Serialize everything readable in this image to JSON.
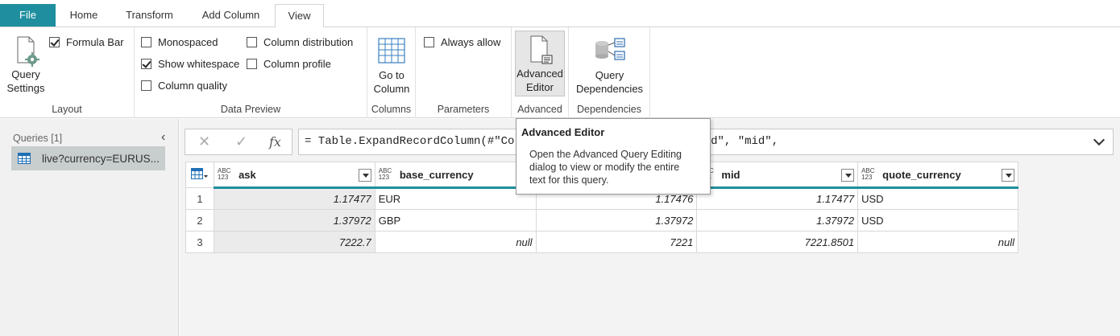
{
  "tabs": [
    {
      "label": "File"
    },
    {
      "label": "Home"
    },
    {
      "label": "Transform"
    },
    {
      "label": "Add Column"
    },
    {
      "label": "View"
    }
  ],
  "ribbon": {
    "layout": {
      "label": "Layout",
      "query_settings": [
        "Query",
        "Settings"
      ],
      "formula_bar": {
        "label": "Formula Bar",
        "checked": true
      }
    },
    "data_preview": {
      "label": "Data Preview",
      "monospaced": {
        "label": "Monospaced",
        "checked": false
      },
      "show_whitespace": {
        "label": "Show whitespace",
        "checked": true
      },
      "column_quality": {
        "label": "Column quality",
        "checked": false
      },
      "column_distribution": {
        "label": "Column distribution",
        "checked": false
      },
      "column_profile": {
        "label": "Column profile",
        "checked": false
      }
    },
    "columns": {
      "label": "Columns",
      "go_to_column": [
        "Go to",
        "Column"
      ]
    },
    "parameters": {
      "label": "Parameters",
      "always_allow": {
        "label": "Always allow",
        "checked": false
      }
    },
    "advanced": {
      "label": "Advanced",
      "advanced_editor": [
        "Advanced",
        "Editor"
      ]
    },
    "dependencies": {
      "label": "Dependencies",
      "query_dependencies": [
        "Query",
        "Dependencies"
      ]
    }
  },
  "queries": {
    "header": "Queries [1]",
    "items": [
      {
        "label": "live?currency=EURUS..."
      }
    ]
  },
  "formula": "= Table.ExpandRecordColumn(#\"Co                              {\"ask\", \"base_currency\", \"bid\", \"mid\",",
  "table": {
    "type_icon": [
      "ABC",
      "123"
    ],
    "columns": [
      "ask",
      "base_currency",
      "",
      "mid",
      "quote_currency"
    ],
    "rows": [
      {
        "n": "1",
        "ask": "1.17477",
        "base": "EUR",
        "bid": "1.17476",
        "mid": "1.17477",
        "quote": "USD"
      },
      {
        "n": "2",
        "ask": "1.37972",
        "base": "GBP",
        "bid": "1.37972",
        "mid": "1.37972",
        "quote": "USD"
      },
      {
        "n": "3",
        "ask": "7222.7",
        "base": "null",
        "bid": "7221",
        "mid": "7221.8501",
        "quote": "null"
      }
    ]
  },
  "tooltip": {
    "title": "Advanced Editor",
    "body": [
      "Open the Advanced Query Editing",
      "dialog to view or modify the entire",
      "text for this query."
    ]
  },
  "colors": {
    "accent": "#1f8f9f",
    "selected_query": "#c8cdcd"
  }
}
